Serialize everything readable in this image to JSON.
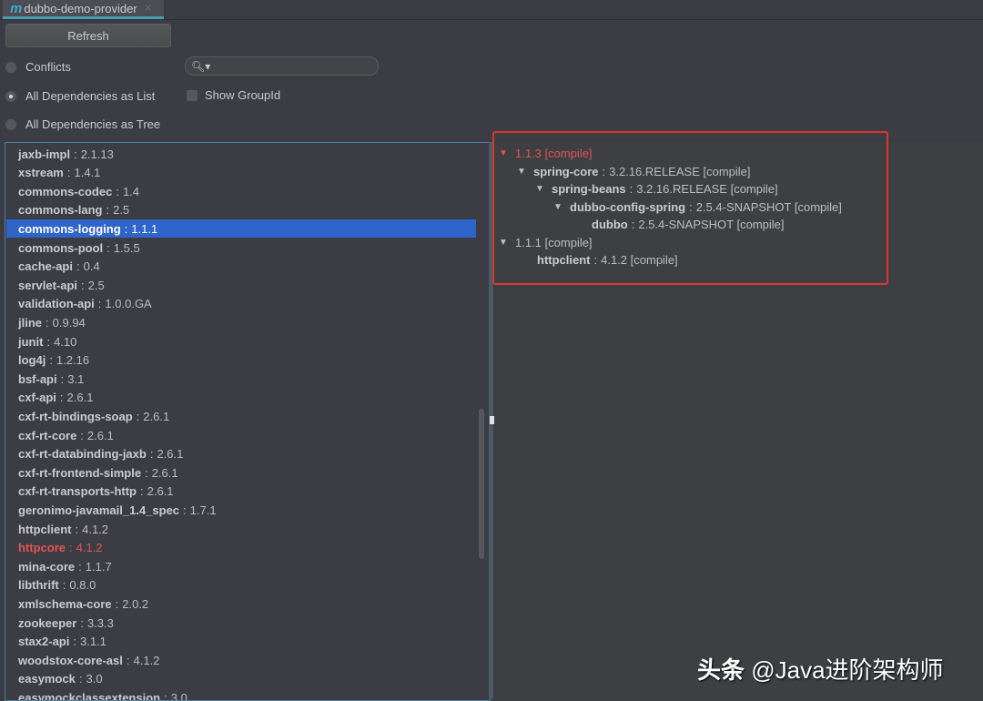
{
  "tab": {
    "label": "dubbo-demo-provider",
    "icon": "maven-m-icon"
  },
  "toolbar": {
    "refresh_label": "Refresh"
  },
  "view_modes": [
    {
      "label": "Conflicts",
      "checked": false
    },
    {
      "label": "All Dependencies as List",
      "checked": true
    },
    {
      "label": "All Dependencies as Tree",
      "checked": false
    }
  ],
  "search": {
    "value": "",
    "placeholder": ""
  },
  "show_groupid": {
    "label": "Show GroupId",
    "checked": false
  },
  "dependencies": [
    {
      "name": "jaxb-impl",
      "version": "2.1.13"
    },
    {
      "name": "xstream",
      "version": "1.4.1"
    },
    {
      "name": "commons-codec",
      "version": "1.4"
    },
    {
      "name": "commons-lang",
      "version": "2.5"
    },
    {
      "name": "commons-logging",
      "version": "1.1.1",
      "selected": true
    },
    {
      "name": "commons-pool",
      "version": "1.5.5"
    },
    {
      "name": "cache-api",
      "version": "0.4"
    },
    {
      "name": "servlet-api",
      "version": "2.5"
    },
    {
      "name": "validation-api",
      "version": "1.0.0.GA"
    },
    {
      "name": "jline",
      "version": "0.9.94"
    },
    {
      "name": "junit",
      "version": "4.10"
    },
    {
      "name": "log4j",
      "version": "1.2.16"
    },
    {
      "name": "bsf-api",
      "version": "3.1"
    },
    {
      "name": "cxf-api",
      "version": "2.6.1"
    },
    {
      "name": "cxf-rt-bindings-soap",
      "version": "2.6.1"
    },
    {
      "name": "cxf-rt-core",
      "version": "2.6.1"
    },
    {
      "name": "cxf-rt-databinding-jaxb",
      "version": "2.6.1"
    },
    {
      "name": "cxf-rt-frontend-simple",
      "version": "2.6.1"
    },
    {
      "name": "cxf-rt-transports-http",
      "version": "2.6.1"
    },
    {
      "name": "geronimo-javamail_1.4_spec",
      "version": "1.7.1"
    },
    {
      "name": "httpclient",
      "version": "4.1.2"
    },
    {
      "name": "httpcore",
      "version": "4.1.2",
      "conflict": true
    },
    {
      "name": "mina-core",
      "version": "1.1.7"
    },
    {
      "name": "libthrift",
      "version": "0.8.0"
    },
    {
      "name": "xmlschema-core",
      "version": "2.0.2"
    },
    {
      "name": "zookeeper",
      "version": "3.3.3"
    },
    {
      "name": "stax2-api",
      "version": "3.1.1"
    },
    {
      "name": "woodstox-core-asl",
      "version": "4.1.2"
    },
    {
      "name": "easymock",
      "version": "3.0"
    },
    {
      "name": "easymockclassextension",
      "version": "3.0"
    }
  ],
  "tree": [
    {
      "level": 0,
      "expanded": true,
      "text": "1.1.3 [compile]",
      "conflict": true
    },
    {
      "level": 1,
      "expanded": true,
      "name": "spring-core",
      "rest": "3.2.16.RELEASE [compile]"
    },
    {
      "level": 2,
      "expanded": true,
      "name": "spring-beans",
      "rest": "3.2.16.RELEASE [compile]"
    },
    {
      "level": 3,
      "expanded": true,
      "name": "dubbo-config-spring",
      "rest": "2.5.4-SNAPSHOT [compile]"
    },
    {
      "level": 4,
      "expanded": false,
      "leaf": true,
      "name": "dubbo",
      "rest": "2.5.4-SNAPSHOT [compile]"
    },
    {
      "level": 0,
      "expanded": true,
      "text": "1.1.1 [compile]"
    },
    {
      "level": 1,
      "expanded": false,
      "leaf": true,
      "name": "httpclient",
      "rest": "4.1.2 [compile]"
    }
  ],
  "watermark": {
    "prefix": "头条",
    "handle": " @Java进阶架构师"
  },
  "colors": {
    "selection": "#2f65ca",
    "conflict": "#e05454",
    "highlight_box": "#d9392b",
    "tab_underline": "#4a9cb0"
  }
}
